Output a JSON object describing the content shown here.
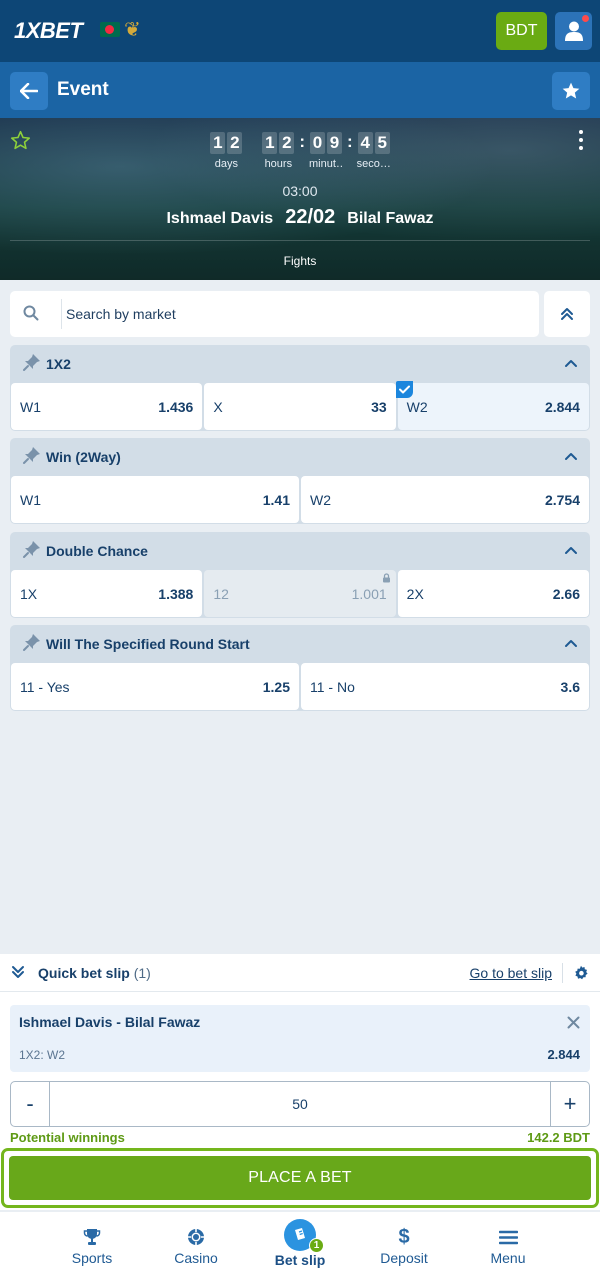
{
  "header": {
    "logo": "1XBET",
    "currency": "BDT"
  },
  "event_bar": {
    "title": "Event"
  },
  "banner": {
    "countdown": [
      {
        "digits": [
          "1",
          "2"
        ],
        "label": "days"
      },
      {
        "digits": [
          "1",
          "2"
        ],
        "label": "hours"
      },
      {
        "digits": [
          "0",
          "9"
        ],
        "label": "minut…"
      },
      {
        "digits": [
          "4",
          "5"
        ],
        "label": "seco…"
      }
    ],
    "time": "03:00",
    "player1": "Ishmael Davis",
    "date": "22/02",
    "player2": "Bilal Fawaz",
    "sport": "Fights"
  },
  "search": {
    "placeholder": "Search by market"
  },
  "markets": [
    {
      "title": "1X2",
      "odds": [
        {
          "label": "W1",
          "value": "1.436"
        },
        {
          "label": "X",
          "value": "33"
        },
        {
          "label": "W2",
          "value": "2.844",
          "selected": true
        }
      ]
    },
    {
      "title": "Win (2Way)",
      "odds": [
        {
          "label": "W1",
          "value": "1.41"
        },
        {
          "label": "W2",
          "value": "2.754"
        }
      ]
    },
    {
      "title": "Double Chance",
      "odds": [
        {
          "label": "1X",
          "value": "1.388"
        },
        {
          "label": "12",
          "value": "1.001",
          "locked": true
        },
        {
          "label": "2X",
          "value": "2.66"
        }
      ]
    },
    {
      "title": "Will The Specified Round Start",
      "odds": [
        {
          "label": "11 - Yes",
          "value": "1.25"
        },
        {
          "label": "11 - No",
          "value": "3.6"
        }
      ]
    }
  ],
  "quick_slip": {
    "title": "Quick bet slip",
    "count": "(1)",
    "goto_label": "Go to bet slip",
    "bet": {
      "teams": "Ishmael Davis - Bilal Fawaz",
      "pick": "1X2: W2",
      "odds": "2.844"
    },
    "stake": {
      "minus": "-",
      "value": "50",
      "plus": "+"
    },
    "winnings_label": "Potential winnings",
    "winnings_value": "142.2 BDT",
    "place_label": "PLACE A BET"
  },
  "nav": {
    "items": [
      {
        "label": "Sports",
        "icon": "trophy-icon"
      },
      {
        "label": "Casino",
        "icon": "casino-chip-icon"
      },
      {
        "label": "Bet slip",
        "icon": "ticket-icon",
        "active": true,
        "badge": "1"
      },
      {
        "label": "Deposit",
        "icon": "dollar-icon"
      },
      {
        "label": "Menu",
        "icon": "hamburger-icon"
      }
    ]
  },
  "colors": {
    "header_bg": "#0d4676",
    "event_bar_bg": "#1b64a4",
    "accent_green": "#6aab13",
    "accent_blue": "#2b93e0"
  }
}
